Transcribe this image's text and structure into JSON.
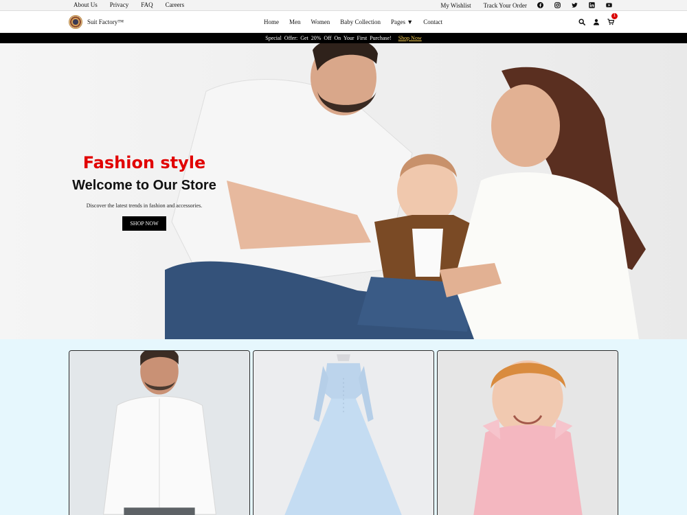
{
  "topbar": {
    "links": [
      "About Us",
      "Privacy",
      "FAQ",
      "Careers"
    ],
    "wishlist": "My Wishlist",
    "track_order": "Track Your Order",
    "social_icons": [
      "facebook-icon",
      "instagram-icon",
      "twitter-icon",
      "linkedin-icon",
      "youtube-icon"
    ]
  },
  "header": {
    "brand": "Suit Factory™",
    "nav": [
      "Home",
      "Men",
      "Women",
      "Baby Collection",
      "Pages ▼",
      "Contact"
    ],
    "cart_count": "1",
    "icons": [
      "search-icon",
      "user-icon",
      "cart-icon"
    ]
  },
  "promo": {
    "text": "Special Offer: Get 20% Off On Your First Purchase!",
    "link": "Shop Now"
  },
  "hero": {
    "kicker": "Fashion style",
    "title": "Welcome to Our Store",
    "subtitle": "Discover the latest trends in fashion and accessories.",
    "button": "SHOP NOW"
  },
  "colors": {
    "accent_red": "#e10000",
    "promo_link": "#f2c94c",
    "section_bg": "#e6f7fd"
  }
}
